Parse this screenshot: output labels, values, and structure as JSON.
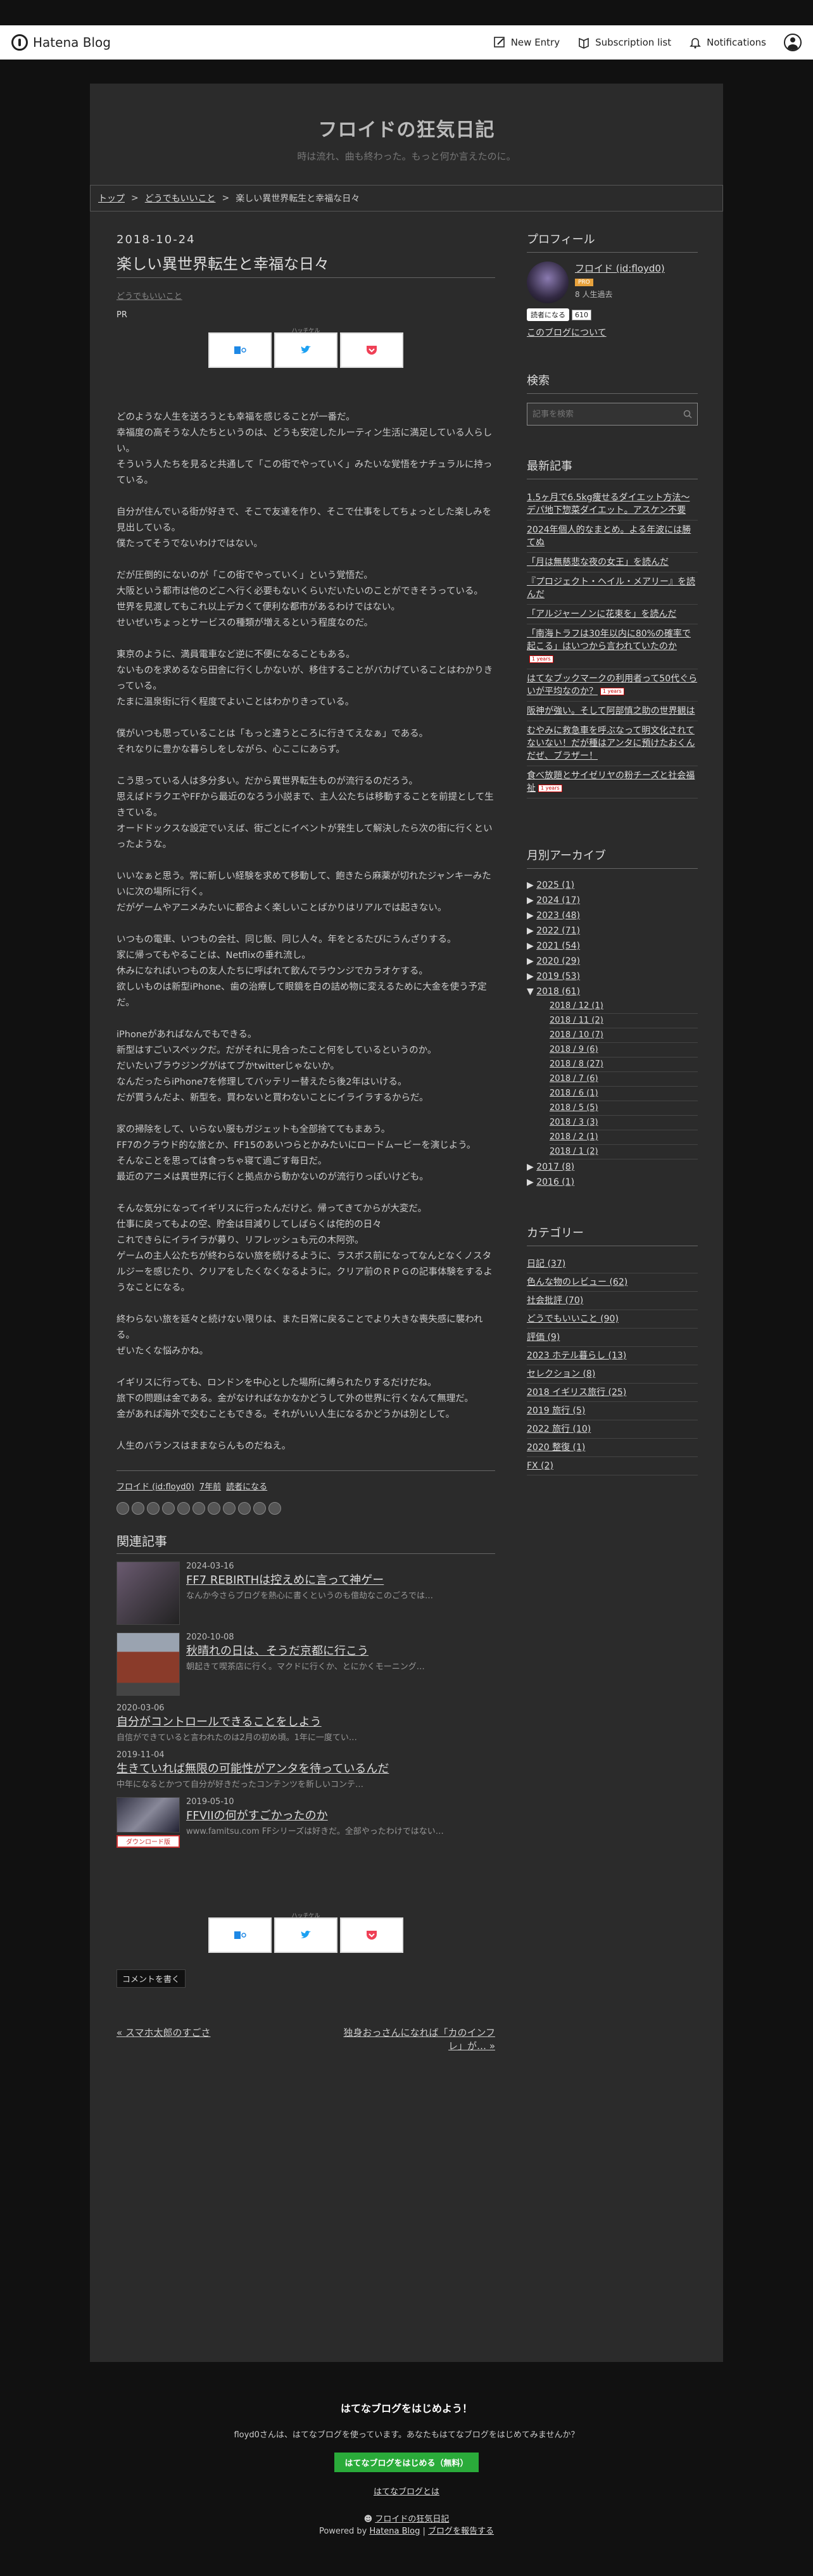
{
  "global_header": {
    "brand": "Hatena Blog",
    "new_entry": "New Entry",
    "subscription_list": "Subscription list",
    "notifications": "Notifications"
  },
  "blog": {
    "title": "フロイドの狂気日記",
    "description": "時は流れ、曲も終わった。もっと何か言えたのに。"
  },
  "breadcrumb": [
    "トップ",
    ">",
    "どうでもいいこと",
    ">",
    "楽しい異世界転生と幸福な日々"
  ],
  "entry": {
    "date": "2018-10-24",
    "title": "楽しい異世界転生と幸福な日々",
    "category": "どうでもいいこと",
    "pr": "PR",
    "share_label": "ハッチケル",
    "paragraphs": [
      "どのような人生を送ろうとも幸福を感じることが一番だ。\n幸福度の高そうな人たちというのは、どうも安定したルーティン生活に満足している人らしい。\nそういう人たちを見ると共通して「この街でやっていく」みたいな覚悟をナチュラルに持っている。",
      "自分が住んでいる街が好きで、そこで友達を作り、そこで仕事をしてちょっとした楽しみを見出している。\n僕たってそうでないわけではない。",
      "だが圧倒的にないのが「この街でやっていく」という覚悟だ。\n大阪という都市は他のどこへ行く必要もないくらいだいたいのことができそうっている。\n世界を見渡してもこれ以上デカくて便利な都市があるわけではない。\nせいぜいちょっとサービスの種類が増えるという程度なのだ。",
      "東京のように、満員電車など逆に不便になることもある。\nないものを求めるなら田舎に行くしかないが、移住することがバカげていることはわかりきっている。\nたまに温泉街に行く程度でよいことはわかりきっている。",
      "僕がいつも思っていることは「もっと違うところに行きてえなぁ」である。\nそれなりに豊かな暮らしをしながら、心ここにあらず。",
      "こう思っている人は多分多い。だから異世界転生ものが流行るのだろう。\n思えばドラクエやFFから最近のなろう小説まで、主人公たちは移動することを前提として生きている。\nオードドックスな設定でいえば、街ごとにイベントが発生して解決したら次の街に行くといったような。",
      "いいなぁと思う。常に新しい経験を求めて移動して、飽きたら麻薬が切れたジャンキーみたいに次の場所に行く。\nだがゲームやアニメみたいに都合よく楽しいことばかりはリアルでは起きない。",
      "いつもの電車、いつもの会社、同じ飯、同じ人々。年をとるたびにうんざりする。\n家に帰ってもやることは、Netflixの垂れ流し。\n休みになればいつもの友人たちに呼ばれて飲んでラウンジでカラオケする。\n欲しいものは新型iPhone、歯の治療して眼鏡を白の詰め物に変えるために大金を使う予定だ。",
      "iPhoneがあればなんでもできる。\n新型はすごいスペックだ。だがそれに見合ったこと何をしているというのか。\nだいたいブラウジングがはてブかtwitterじゃないか。\nなんだったらiPhone7を修理してバッテリー替えたら後2年はいける。\nだが買うんだよ、新型を。買わないと買わないことにイライラするからだ。",
      "家の掃除をして、いらない服もガジェットも全部捨ててもまあう。\nFF7のクラウド的な旅とか、FF15のあいつらとかみたいにロードムービーを演じよう。\nそんなことを思っては食っちゃ寝て過ごす毎日だ。\n最近のアニメは異世界に行くと拠点から動かないのが流行りっぽいけども。",
      "そんな気分になってイギリスに行ったんだけど。帰ってきてからが大変だ。\n仕事に戻ってもよの空、貯金は目減りしてしばらくは侘的の日々\nこれできらにイライラが募り、リフレッシュも元の木阿弥。\nゲームの主人公たちが終わらない旅を続けるように、ラスボス前になってなんとなくノスタルジーを感じたり、クリアをしたくなくなるように。クリア前のＲＰＧの記事体験をするようなことになる。",
      "終わらない旅を延々と続けない限りは、また日常に戻ることでより大きな喪失感に襲われる。\nぜいたくな悩みかね。",
      "イギリスに行っても、ロンドンを中心とした場所に縛られたりするだけだね。\n旅下の問題は金である。金がなければなかなかどうして外の世界に行くなんて無理だ。\n金があれば海外で交むこともできる。それがいい人生になるかどうかは別として。",
      "人生のバランスはままならんものだねえ。"
    ],
    "author_line": "フロイド (id:floyd0)",
    "time_ago": "7年前",
    "reader_link": "読者になる"
  },
  "related": {
    "heading": "関連記事",
    "items": [
      {
        "date": "2024-03-16",
        "title": "FF7 REBIRTHは控えめに言って神ゲー",
        "excerpt": "なんか今さらブログを熱心に書くというのも億劫なこのごろでは…",
        "thumb": "t1"
      },
      {
        "date": "2020-10-08",
        "title": "秋晴れの日は、そうだ京都に行こう",
        "excerpt": "朝起きて喫茶店に行く。マクドに行くか、とにかくモーニング…",
        "thumb": "t2"
      },
      {
        "date": "2020-03-06",
        "title": "自分がコントロールできることをしよう",
        "excerpt": "自信ができていると言われたのは2月の初め頃。1年に一度てい…",
        "thumb": ""
      },
      {
        "date": "2019-11-04",
        "title": "生きていれば無限の可能性がアンタを待っているんだ",
        "excerpt": "中年になるとかつて自分が好きだったコンテンツを新しいコンテ…",
        "thumb": ""
      },
      {
        "date": "2019-05-10",
        "title": "FFVIIの何がすごかったのか",
        "excerpt": "www.famitsu.com FFシリーズは好きだ。全部やったわけではない…",
        "thumb": "t3"
      }
    ],
    "download_badge": "ダウンロード版"
  },
  "comment_button": "コメントを書く",
  "pager": {
    "prev": "« スマホ太郎のすごさ",
    "next": "独身おっさんになれば「カのインフレ」が… »"
  },
  "sidebar": {
    "profile_heading": "プロフィール",
    "profile_name": "フロイド (id:floyd0)",
    "pro": "PRO",
    "duration": "8 人生過去",
    "reader_button": "読者になる",
    "reader_count": "610",
    "about_link": "このブログについて",
    "search_heading": "検索",
    "search_placeholder": "記事を検索",
    "recent_heading": "最新記事",
    "recent": [
      {
        "title": "1.5ヶ月で6.5kg痩せるダイエット方法〜デパ地下惣菜ダイエット。アスケン不要",
        "new": false
      },
      {
        "title": "2024年個人的なまとめ。よる年波には勝てぬ",
        "new": false
      },
      {
        "title": "「月は無慈悲な夜の女王」を読んだ",
        "new": false
      },
      {
        "title": "『プロジェクト・ヘイル・メアリー』を読んだ",
        "new": false
      },
      {
        "title": "「アルジャーノンに花束を」を読んだ",
        "new": false
      },
      {
        "title": "「南海トラフは30年以内に80%の確率で起こる」はいつから言われていたのか",
        "new": true
      },
      {
        "title": "はてなブックマークの利用者って50代ぐらいが平均なのか？",
        "new": true
      },
      {
        "title": "阪神が強い。そして阿部慎之助の世界観は",
        "new": false
      },
      {
        "title": "むやみに救急車を呼ぶなって明文化されてないない！だが種はアンタに預けたおくんだぜ、ブラザー！",
        "new": false
      },
      {
        "title": "食べ放題とサイゼリヤの粉チーズと社会福祉",
        "new": true
      }
    ],
    "new_label": "1 years",
    "archive_heading": "月別アーカイブ",
    "archive": [
      {
        "year": "2025 (1)",
        "open": false
      },
      {
        "year": "2024 (17)",
        "open": false
      },
      {
        "year": "2023 (48)",
        "open": false
      },
      {
        "year": "2022 (71)",
        "open": false
      },
      {
        "year": "2021 (54)",
        "open": false
      },
      {
        "year": "2020 (29)",
        "open": false
      },
      {
        "year": "2019 (53)",
        "open": false
      },
      {
        "year": "2018 (61)",
        "open": true
      },
      {
        "year": "2017 (8)",
        "open": false
      },
      {
        "year": "2016 (1)",
        "open": false
      }
    ],
    "months_2018": [
      "2018 / 12 (1)",
      "2018 / 11 (2)",
      "2018 / 10 (7)",
      "2018 / 9 (6)",
      "2018 / 8 (27)",
      "2018 / 7 (6)",
      "2018 / 6 (1)",
      "2018 / 5 (5)",
      "2018 / 3 (3)",
      "2018 / 2 (1)",
      "2018 / 1 (2)"
    ],
    "category_heading": "カテゴリー",
    "categories": [
      "日記 (37)",
      "色んな物のレビュー (62)",
      "社会批評 (70)",
      "どうでもいいこと (90)",
      "評価 (9)",
      "2023 ホテル暮らし (13)",
      "セレクション (8)",
      "2018 イギリス旅行 (25)",
      "2019 旅行 (5)",
      "2022 旅行 (10)",
      "2020 整復 (1)",
      "FX (2)"
    ]
  },
  "footer": {
    "title": "はてなブログをはじめよう！",
    "desc": "floyd0さんは、はてなブログを使っています。あなたもはてなブログをはじめてみませんか？",
    "start": "はてなブログをはじめる（無料）",
    "what": "はてなブログとは",
    "blog_link": "フロイドの狂気日記",
    "powered_prefix": "Powered by",
    "powered_link": "Hatena Blog",
    "sep": "|",
    "report": "ブログを報告する"
  },
  "colors": {
    "page_bg": "#2b2b2b",
    "body_bg": "#111111",
    "start_button": "#2aab3a",
    "pro_badge": "#e8a33d"
  }
}
